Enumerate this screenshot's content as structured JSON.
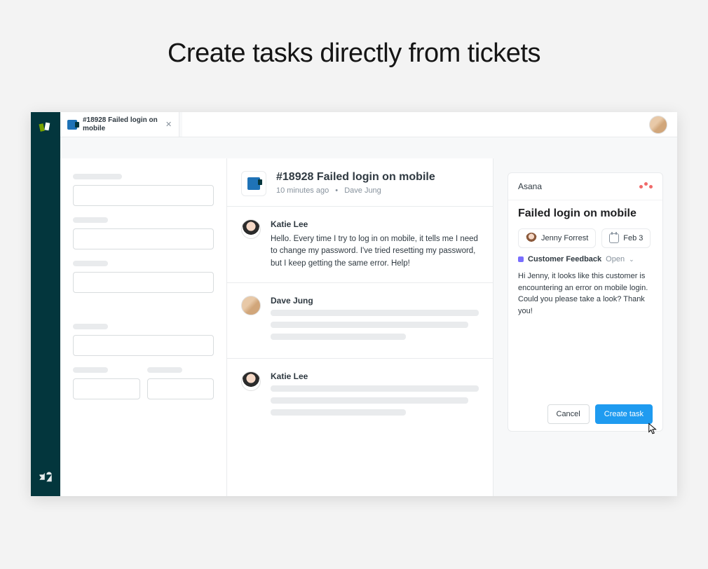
{
  "hero": {
    "title": "Create tasks directly from tickets"
  },
  "tab": {
    "title": "#18928 Failed login on mobile"
  },
  "ticket": {
    "title": "#18928 Failed login on mobile",
    "time": "10 minutes ago",
    "requester": "Dave Jung"
  },
  "messages": [
    {
      "author": "Katie Lee",
      "text": "Hello. Every time I try to log in on mobile, it tells me I need to change my password. I've tried resetting my password, but I keep getting the same error. Help!"
    },
    {
      "author": "Dave Jung",
      "text": ""
    },
    {
      "author": "Katie Lee",
      "text": ""
    }
  ],
  "asana": {
    "app": "Asana",
    "title": "Failed login on mobile",
    "assignee": "Jenny Forrest",
    "due": "Feb 3",
    "project": "Customer Feedback",
    "status": "Open",
    "description": "Hi Jenny, it looks like this customer is encountering an error on mobile login. Could you please take a look? Thank you!",
    "cancel_label": "Cancel",
    "create_label": "Create task"
  }
}
